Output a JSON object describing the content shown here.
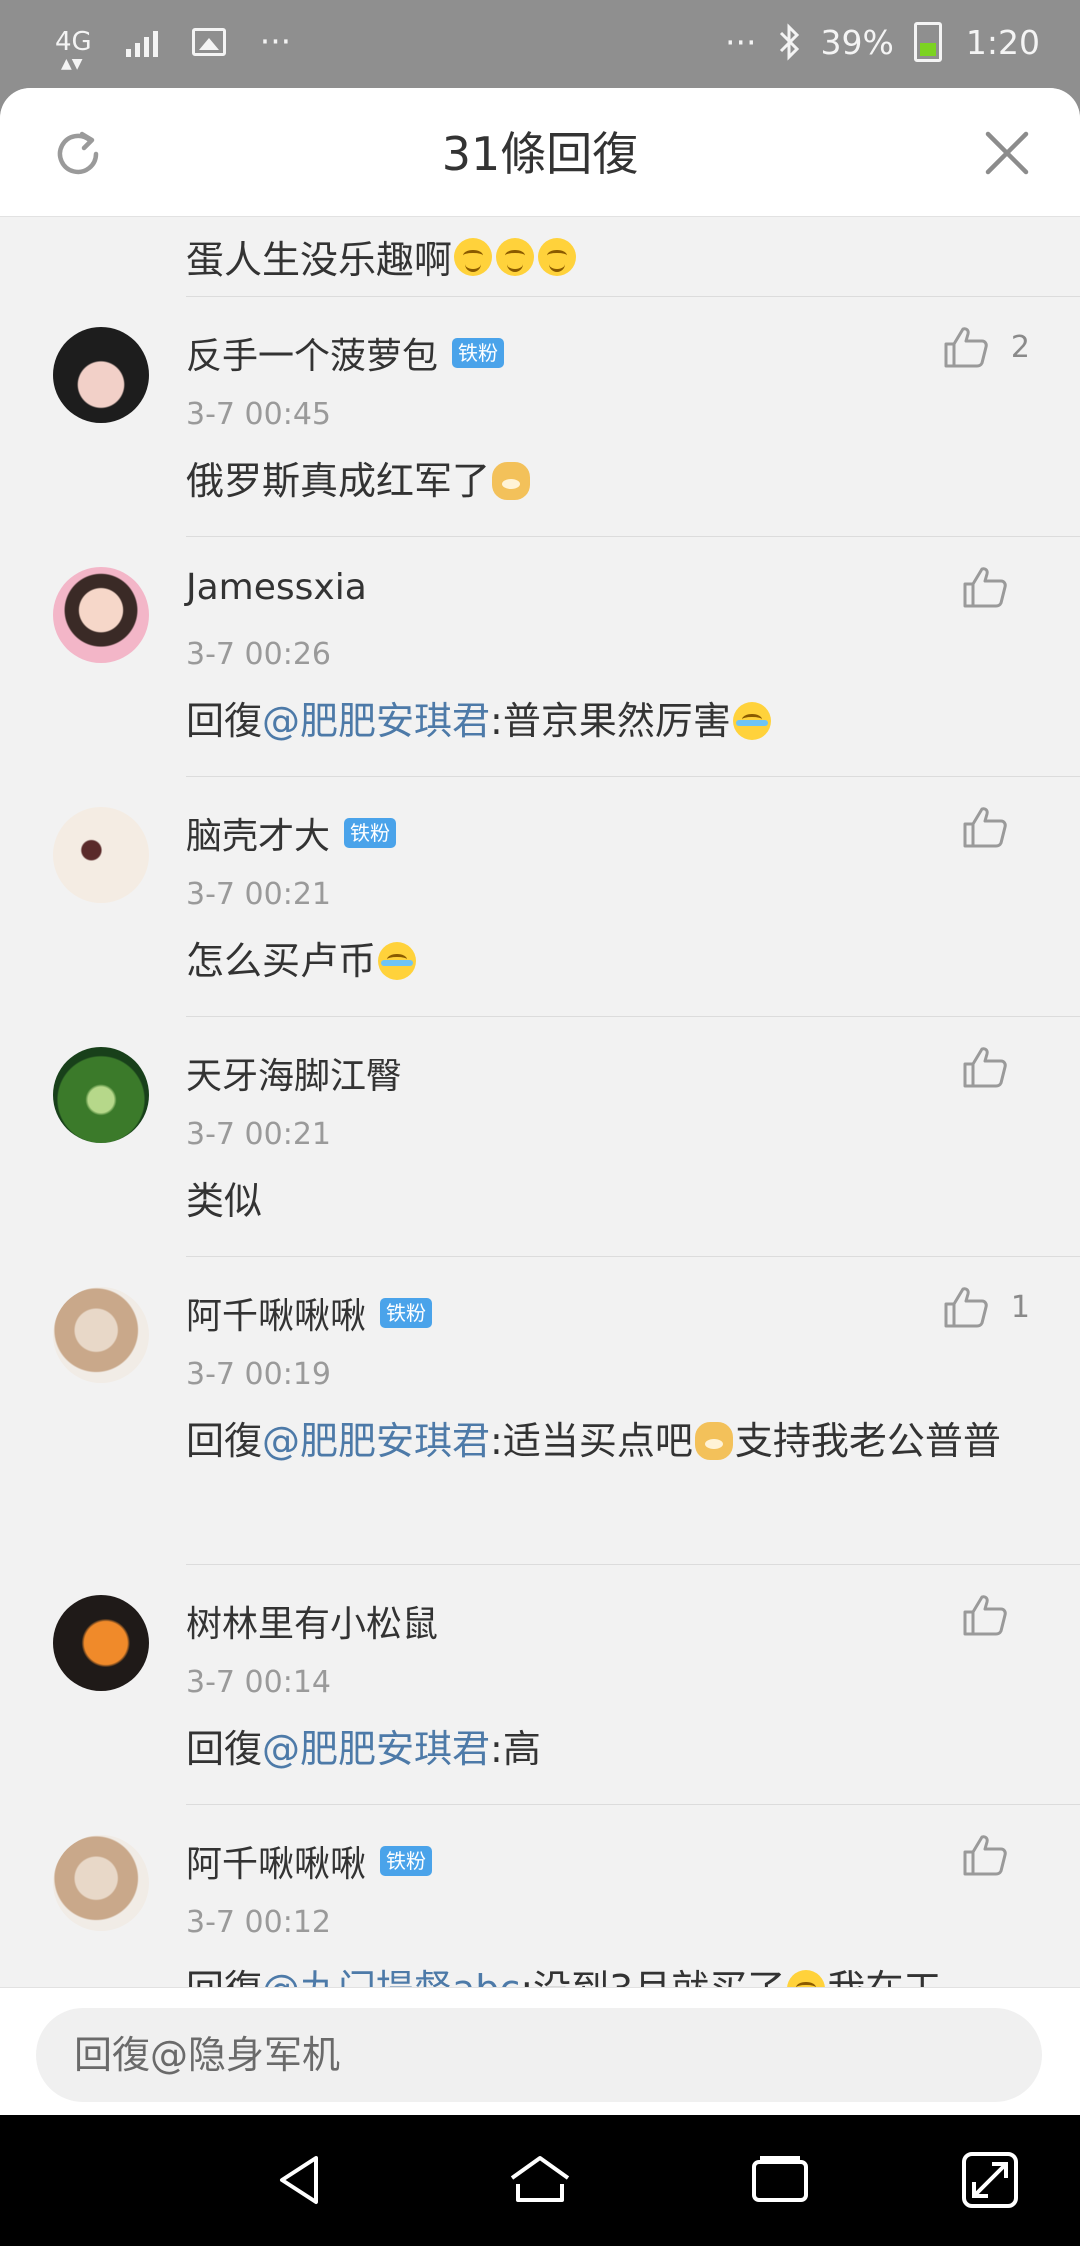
{
  "status_bar": {
    "network": "4G",
    "more": "···",
    "more_right": "···",
    "battery": "39%",
    "time": "1:20"
  },
  "sheet": {
    "title": "31條回復",
    "partial_comment_text": "蛋人生没乐趣啊"
  },
  "comments": [
    {
      "name": "反手一个菠萝包",
      "badge": "铁粉",
      "time": "3-7 00:45",
      "text": "俄罗斯真成红军了",
      "likes": "2"
    },
    {
      "name": "Jamessxia",
      "badge": "",
      "time": "3-7 00:26",
      "reply_prefix": "回復",
      "mention": "@肥肥安琪君",
      "text": ":普京果然厉害",
      "likes": ""
    },
    {
      "name": "脑壳才大",
      "badge": "铁粉",
      "time": "3-7 00:21",
      "text": "怎么买卢币",
      "likes": ""
    },
    {
      "name": "天牙海脚江臀",
      "badge": "",
      "time": "3-7 00:21",
      "text": "类似",
      "likes": ""
    },
    {
      "name": "阿千啾啾啾",
      "badge": "铁粉",
      "time": "3-7 00:19",
      "reply_prefix": "回復",
      "mention": "@肥肥安琪君",
      "text": ":适当买点吧",
      "text2": "支持我老公普普",
      "likes": "1"
    },
    {
      "name": "树林里有小松鼠",
      "badge": "",
      "time": "3-7 00:14",
      "reply_prefix": "回復",
      "mention": "@肥肥安琪君",
      "text": ":高",
      "likes": ""
    },
    {
      "name": "阿千啾啾啾",
      "badge": "铁粉",
      "time": "3-7 00:12",
      "reply_prefix": "回復",
      "mention": "@九门提督abc",
      "text": ":没到3月就买了",
      "text2": "我在工",
      "likes": ""
    }
  ],
  "input": {
    "placeholder": "回復@隐身军机"
  },
  "icons": {
    "refresh": "refresh-icon",
    "close": "close-icon",
    "like": "thumbs-up-icon",
    "nav_back": "back-triangle-icon",
    "nav_home": "home-icon",
    "nav_recent": "recent-apps-icon",
    "nav_expand": "expand-icon"
  },
  "colors": {
    "badge": "#4aa3ea",
    "mention": "#4d7aa8",
    "battery_fill": "#7cd321"
  }
}
